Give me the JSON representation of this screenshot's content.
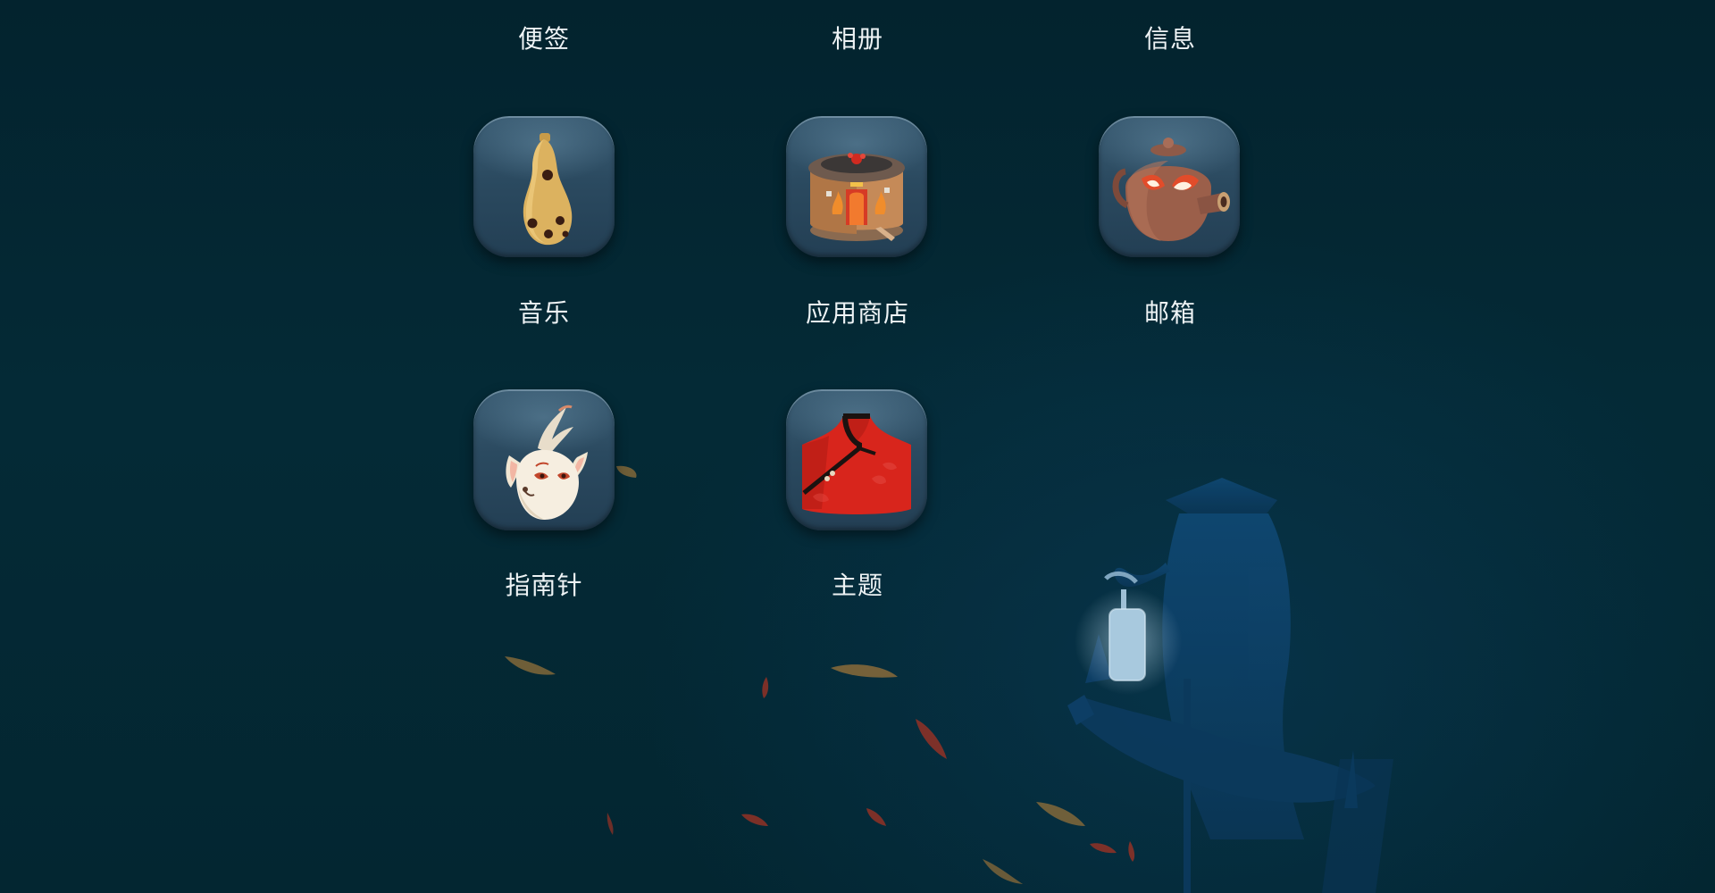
{
  "top_row_labels": [
    "便签",
    "相册",
    "信息"
  ],
  "apps": [
    {
      "label": "音乐",
      "icon": "ocarina-icon"
    },
    {
      "label": "应用商店",
      "icon": "shop-building-icon"
    },
    {
      "label": "邮箱",
      "icon": "teapot-icon"
    },
    {
      "label": "指南针",
      "icon": "deer-spirit-icon"
    },
    {
      "label": "主题",
      "icon": "red-jacket-icon"
    }
  ],
  "colors": {
    "background": "#032530",
    "label": "#eef3f5",
    "tile": "#2b4a60",
    "silhouette": "#0d3f66",
    "lantern_glow": "#bcd8ea"
  }
}
